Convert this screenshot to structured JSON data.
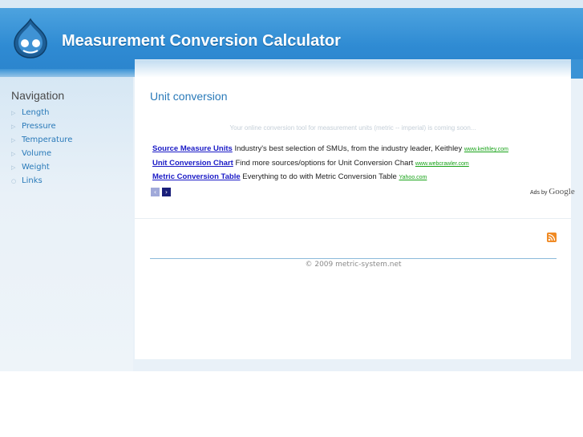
{
  "header": {
    "site_title": "Measurement Conversion Calculator",
    "logo_icon": "drupal-drop-logo"
  },
  "sidebar": {
    "title": "Navigation",
    "items": [
      {
        "label": "Length"
      },
      {
        "label": "Pressure"
      },
      {
        "label": "Temperature"
      },
      {
        "label": "Volume"
      },
      {
        "label": "Weight"
      },
      {
        "label": "Links"
      }
    ]
  },
  "main": {
    "title": "Unit conversion",
    "notice": "Your online conversion tool for measurement units (metric -- imperial) is coming soon...",
    "ads": [
      {
        "link": "Source Measure Units",
        "text": "Industry's best selection of SMUs, from the industry leader, Keithley",
        "url": "www.keithley.com"
      },
      {
        "link": "Unit Conversion Chart",
        "text": "Find more sources/options for Unit Conversion Chart",
        "url": "www.webcrawler.com"
      },
      {
        "link": "Metric Conversion Table",
        "text": "Everything to do with Metric Conversion Table",
        "url": "Yahoo.com"
      }
    ],
    "ads_by_prefix": "Ads by",
    "ads_by_brand": "Google"
  },
  "footer": {
    "copyright": "© 2009 metric-system.net"
  },
  "colors": {
    "header_blue": "#2f8bd3",
    "link_blue": "#2a7ab9",
    "ad_link": "#1a1ac6",
    "ad_url": "#19a319",
    "rss_orange": "#f08a24"
  }
}
